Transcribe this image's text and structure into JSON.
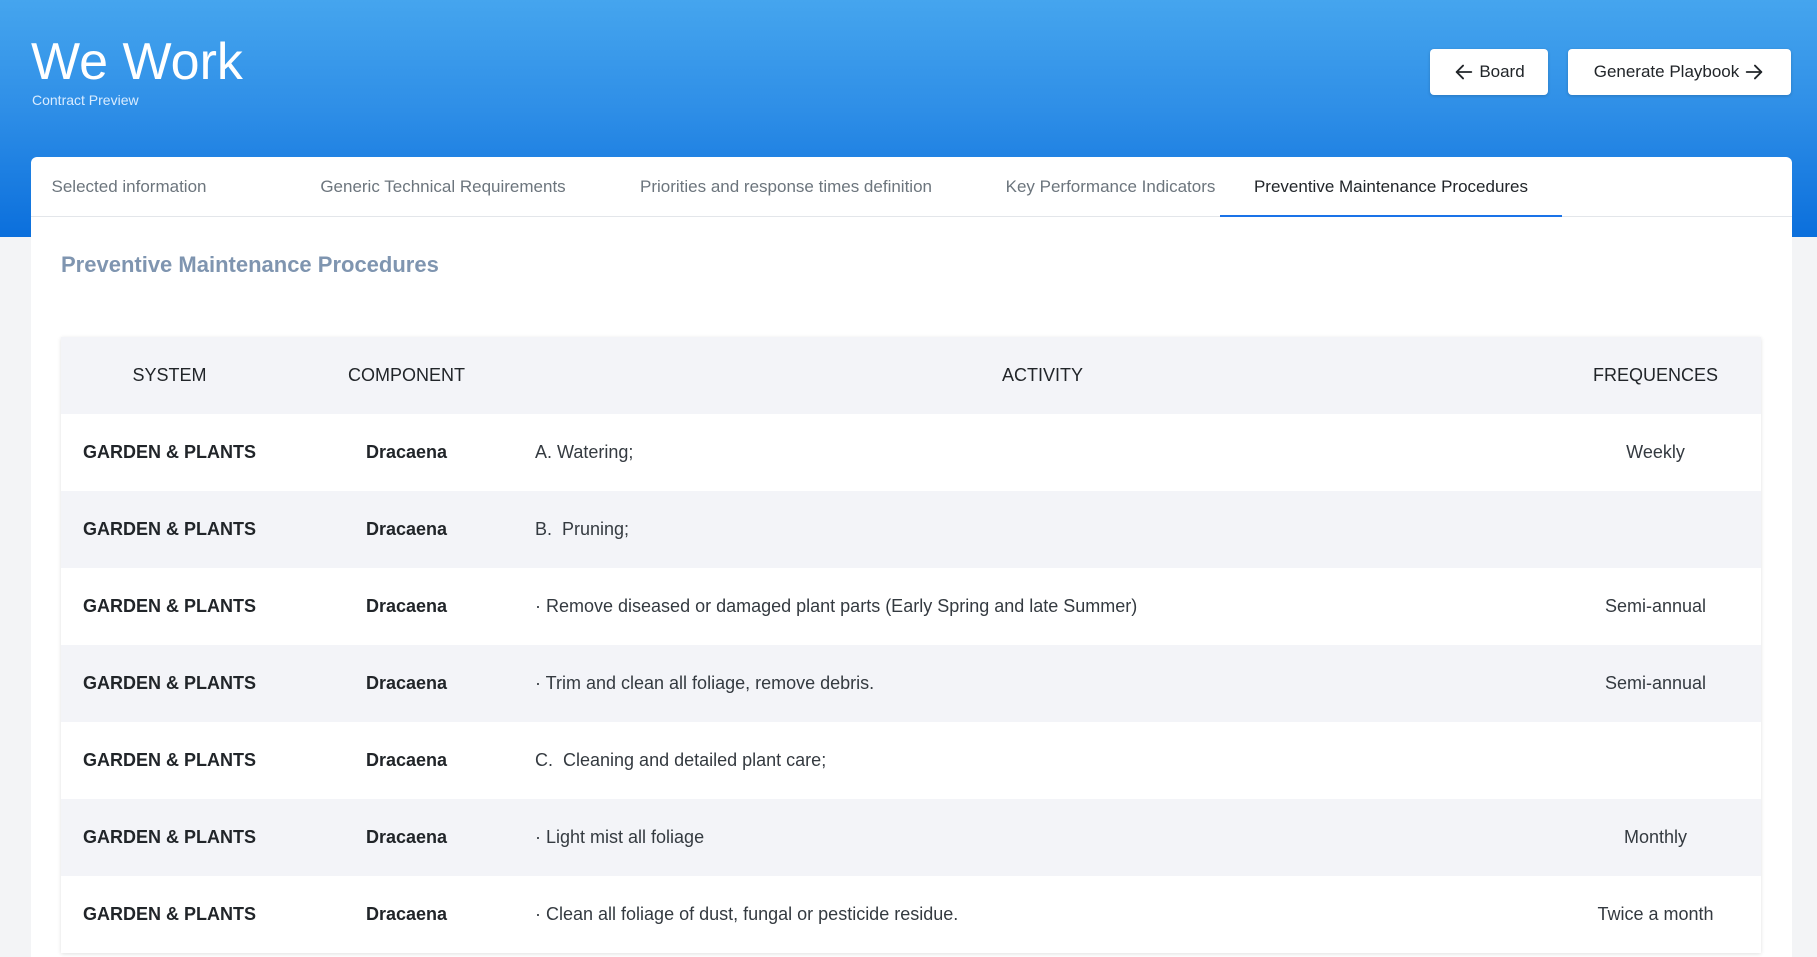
{
  "header": {
    "title": "We Work",
    "subtitle": "Contract Preview",
    "board_button_label": "Board",
    "playbook_button_label": "Generate Playbook"
  },
  "tabs": [
    {
      "label": "Selected information",
      "active": false
    },
    {
      "label": "Generic Technical Requirements",
      "active": false
    },
    {
      "label": "Priorities and response times definition",
      "active": false
    },
    {
      "label": "Key Performance Indicators",
      "active": false
    },
    {
      "label": "Preventive Maintenance Procedures",
      "active": true
    }
  ],
  "section": {
    "title": "Preventive Maintenance Procedures"
  },
  "table": {
    "columns": {
      "system": "SYSTEM",
      "component": "COMPONENT",
      "activity": "ACTIVITY",
      "frequency": "FREQUENCES"
    },
    "rows": [
      {
        "system": "GARDEN & PLANTS",
        "component": "Dracaena",
        "activity": "A. Watering;",
        "frequency": "Weekly"
      },
      {
        "system": "GARDEN & PLANTS",
        "component": "Dracaena",
        "activity": "B.  Pruning;",
        "frequency": ""
      },
      {
        "system": "GARDEN & PLANTS",
        "component": "Dracaena",
        "activity": "· Remove diseased or damaged plant parts (Early Spring and late Summer)",
        "frequency": "Semi-annual"
      },
      {
        "system": "GARDEN & PLANTS",
        "component": "Dracaena",
        "activity": "· Trim and clean all foliage, remove debris.",
        "frequency": "Semi-annual"
      },
      {
        "system": "GARDEN & PLANTS",
        "component": "Dracaena",
        "activity": "C.  Cleaning and detailed plant care;",
        "frequency": ""
      },
      {
        "system": "GARDEN & PLANTS",
        "component": "Dracaena",
        "activity": "· Light mist all foliage",
        "frequency": "Monthly"
      },
      {
        "system": "GARDEN & PLANTS",
        "component": "Dracaena",
        "activity": "· Clean all foliage of dust, fungal or pesticide residue.",
        "frequency": "Twice a month"
      }
    ]
  },
  "colors": {
    "header_gradient_top": "#45a5ee",
    "header_gradient_bottom": "#0b6fdc",
    "active_tab_underline": "#1a73e8",
    "section_title": "#7f95b0",
    "row_stripe": "#f3f4f8"
  },
  "icons": {
    "board_button": "arrow-left-icon",
    "playbook_button": "arrow-right-icon"
  }
}
